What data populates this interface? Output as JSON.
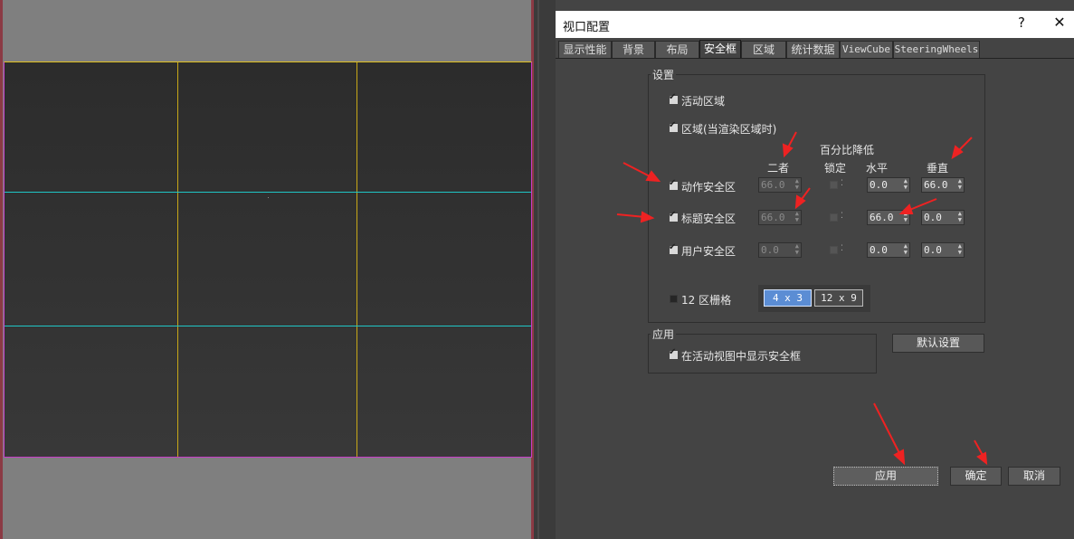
{
  "dialog": {
    "title": "视口配置",
    "help_label": "?",
    "close_label": "✕",
    "tabs": [
      {
        "label": "显示性能"
      },
      {
        "label": "背景"
      },
      {
        "label": "布局"
      },
      {
        "label": "安全框"
      },
      {
        "label": "区域"
      },
      {
        "label": "统计数据"
      },
      {
        "label": "ViewCube"
      },
      {
        "label": "SteeringWheels"
      }
    ],
    "active_tab": "安全框"
  },
  "settings": {
    "title": "设置",
    "live_area": {
      "label": "活动区域",
      "checked": true
    },
    "region": {
      "label": "区域(当渲染区域时)",
      "checked": true
    },
    "percent_header": "百分比降低",
    "col_both": "二者",
    "col_lock": "锁定",
    "col_horizontal": "水平",
    "col_vertical": "垂直",
    "rows": [
      {
        "label": "动作安全区",
        "checked": true,
        "both": "66.0",
        "horizontal": "0.0",
        "vertical": "66.0"
      },
      {
        "label": "标题安全区",
        "checked": true,
        "both": "66.0",
        "horizontal": "66.0",
        "vertical": "0.0"
      },
      {
        "label": "用户安全区",
        "checked": true,
        "both": "0.0",
        "horizontal": "0.0",
        "vertical": "0.0"
      }
    ],
    "grid": {
      "checkbox_label": "12 区栅格",
      "checked": false,
      "options": [
        "4 x 3",
        "12 x 9"
      ],
      "selected": "4 x 3"
    }
  },
  "application": {
    "title": "应用",
    "show_in_active": {
      "label": "在活动视图中显示安全框",
      "checked": true
    },
    "default_button": "默认设置"
  },
  "footer": {
    "apply": "应用",
    "ok": "确定",
    "cancel": "取消"
  },
  "colors": {
    "live_area_line": "#e0c020",
    "grid_h_line": "#1fc6c6",
    "frame_side": "#c83cc8",
    "annotation_arrow": "#ee2222",
    "selected_grid": "#5b8dd4"
  }
}
